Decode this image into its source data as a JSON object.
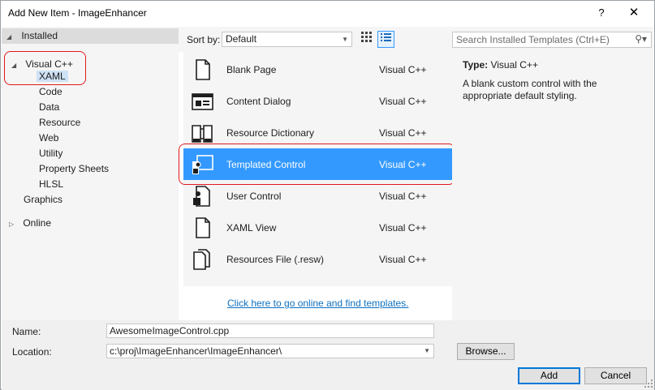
{
  "window": {
    "title": "Add New Item - ImageEnhancer",
    "help_glyph": "?",
    "close_glyph": "✕"
  },
  "tree": {
    "installed": "Installed",
    "visual_cpp": "Visual C++",
    "xaml": "XAML",
    "children": [
      "Code",
      "Data",
      "Resource",
      "Web",
      "Utility",
      "Property Sheets",
      "HLSL"
    ],
    "graphics": "Graphics",
    "online": "Online"
  },
  "toolbar": {
    "sort_label": "Sort by:",
    "sort_value": "Default",
    "search_placeholder": "Search Installed Templates (Ctrl+E)"
  },
  "templates": [
    {
      "name": "Blank Page",
      "lang": "Visual C++",
      "icon": "blank-page-icon"
    },
    {
      "name": "Content Dialog",
      "lang": "Visual C++",
      "icon": "content-dialog-icon"
    },
    {
      "name": "Resource Dictionary",
      "lang": "Visual C++",
      "icon": "resource-dictionary-icon"
    },
    {
      "name": "Templated Control",
      "lang": "Visual C++",
      "icon": "templated-control-icon",
      "selected": true
    },
    {
      "name": "User Control",
      "lang": "Visual C++",
      "icon": "user-control-icon"
    },
    {
      "name": "XAML View",
      "lang": "Visual C++",
      "icon": "xaml-view-icon"
    },
    {
      "name": "Resources File (.resw)",
      "lang": "Visual C++",
      "icon": "resources-file-icon"
    }
  ],
  "details": {
    "type_label": "Type:",
    "type_value": "Visual C++",
    "description": "A blank custom control with the appropriate default styling."
  },
  "online_link": "Click here to go online and find templates.",
  "form": {
    "name_label": "Name:",
    "name_value": "AwesomeImageControl.cpp",
    "location_label": "Location:",
    "location_value": "c:\\proj\\ImageEnhancer\\ImageEnhancer\\",
    "browse_label": "Browse...",
    "add_label": "Add",
    "cancel_label": "Cancel"
  },
  "colors": {
    "selection": "#3399ff",
    "highlight_oval": "#e0191f",
    "link": "#0e70c0"
  }
}
